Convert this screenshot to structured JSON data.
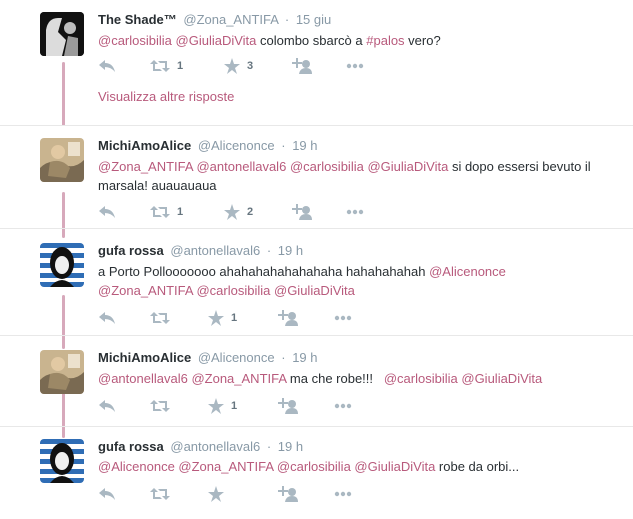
{
  "colors": {
    "accent": "#b85a7c",
    "thread": "#d7a9bb",
    "muted": "#8899a6",
    "icon": "#aab8c2"
  },
  "more_replies": "Visualizza altre risposte",
  "tweets": [
    {
      "name": "The Shade™",
      "handle": "@Zona_ANTIFA",
      "time": "15 giu",
      "avatar": "shade-avatar",
      "text_parts": [
        {
          "t": "@carlosibilia",
          "m": true
        },
        {
          "t": " ",
          "m": false
        },
        {
          "t": "@GiuliaDiVita",
          "m": true
        },
        {
          "t": " colombo sbarcò a ",
          "m": false
        },
        {
          "t": "#palos",
          "m": true
        },
        {
          "t": " vero?",
          "m": false
        }
      ],
      "retweets": "1",
      "likes": "3"
    },
    {
      "name": "MichiAmoAlice",
      "handle": "@Alicenonce",
      "time": "19 h",
      "avatar": "michi-avatar",
      "text_parts": [
        {
          "t": "@Zona_ANTIFA",
          "m": true
        },
        {
          "t": " ",
          "m": false
        },
        {
          "t": "@antonellaval6",
          "m": true
        },
        {
          "t": " ",
          "m": false
        },
        {
          "t": "@carlosibilia",
          "m": true
        },
        {
          "t": " ",
          "m": false
        },
        {
          "t": "@GiuliaDiVita",
          "m": true
        },
        {
          "t": " si dopo essersi bevuto il marsala! auauauaua",
          "m": false
        }
      ],
      "retweets": "1",
      "likes": "2"
    },
    {
      "name": "gufa rossa",
      "handle": "@antonellaval6",
      "time": "19 h",
      "avatar": "gufa-avatar",
      "text_parts": [
        {
          "t": "a Porto Pollooooooo ahahahahahahahaha hahahahahah ",
          "m": false
        },
        {
          "t": "@Alicenonce",
          "m": true
        },
        {
          "t": " ",
          "m": false
        },
        {
          "t": "@Zona_ANTIFA",
          "m": true
        },
        {
          "t": " ",
          "m": false
        },
        {
          "t": "@carlosibilia",
          "m": true
        },
        {
          "t": " ",
          "m": false
        },
        {
          "t": "@GiuliaDiVita",
          "m": true
        }
      ],
      "retweets": "",
      "likes": "1"
    },
    {
      "name": "MichiAmoAlice",
      "handle": "@Alicenonce",
      "time": "19 h",
      "avatar": "michi-avatar",
      "text_parts": [
        {
          "t": "@antonellaval6",
          "m": true
        },
        {
          "t": " ",
          "m": false
        },
        {
          "t": "@Zona_ANTIFA",
          "m": true
        },
        {
          "t": " ma che robe!!!   ",
          "m": false
        },
        {
          "t": "@carlosibilia",
          "m": true
        },
        {
          "t": " ",
          "m": false
        },
        {
          "t": "@GiuliaDiVita",
          "m": true
        }
      ],
      "retweets": "",
      "likes": "1"
    },
    {
      "name": "gufa rossa",
      "handle": "@antonellaval6",
      "time": "19 h",
      "avatar": "gufa-avatar",
      "text_parts": [
        {
          "t": "@Alicenonce",
          "m": true
        },
        {
          "t": " ",
          "m": false
        },
        {
          "t": "@Zona_ANTIFA",
          "m": true
        },
        {
          "t": " ",
          "m": false
        },
        {
          "t": "@carlosibilia",
          "m": true
        },
        {
          "t": " ",
          "m": false
        },
        {
          "t": "@GiuliaDiVita",
          "m": true
        },
        {
          "t": " robe da orbi...",
          "m": false
        }
      ],
      "retweets": "",
      "likes": ""
    }
  ]
}
